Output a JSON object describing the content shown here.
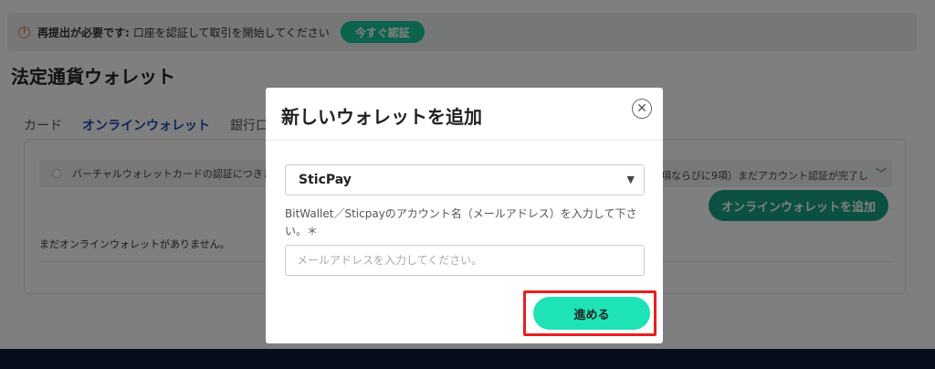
{
  "alert": {
    "icon": "info-circle-icon",
    "strong_text": "再提出が必要です:",
    "message": "口座を認証して取引を開始してください",
    "verify_button": "今すぐ認証"
  },
  "page": {
    "title": "法定通貨ウォレット"
  },
  "tabs": [
    {
      "label": "カード"
    },
    {
      "label": "オンラインウォレット"
    },
    {
      "label": "銀行口"
    }
  ],
  "panel": {
    "notice_text": "バーチャルウォレットカードの認証につきまし",
    "notice_right_text": "項ならびに9項）まだアカウント認証が完了し",
    "add_wallet_button": "オンラインウォレットを追加",
    "empty_message": "まだオンラインウォレットがありません。"
  },
  "modal": {
    "title": "新しいウォレットを追加",
    "wallet_select_value": "SticPay",
    "field_label": "BitWallet／Sticpayのアカウント名（メールアドレス）を入力して下さい。＊",
    "email_placeholder": "メールアドレスを入力してください。",
    "submit_button": "進める"
  },
  "colors": {
    "accent": "#16c79a",
    "primary_tab": "#1a4fb5",
    "highlight_border": "#e62020",
    "footer": "#0f1a36"
  }
}
